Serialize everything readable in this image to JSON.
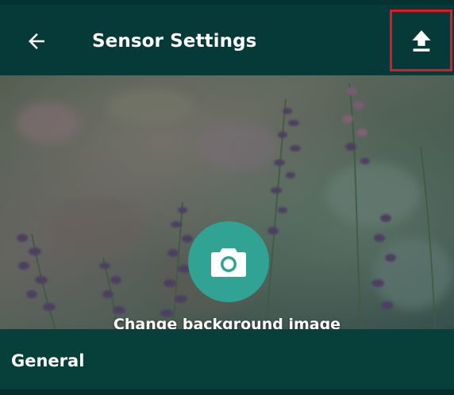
{
  "header": {
    "title": "Sensor Settings",
    "back_icon": "arrow-left-icon",
    "upload_icon": "upload-icon"
  },
  "hero": {
    "camera_icon": "camera-icon",
    "change_background_label": "Change background image"
  },
  "sections": {
    "general_title": "General"
  },
  "colors": {
    "appbar_bg": "#063a38",
    "accent_teal": "#31a394",
    "highlight_border": "#e5161f",
    "text": "#ffffff"
  }
}
